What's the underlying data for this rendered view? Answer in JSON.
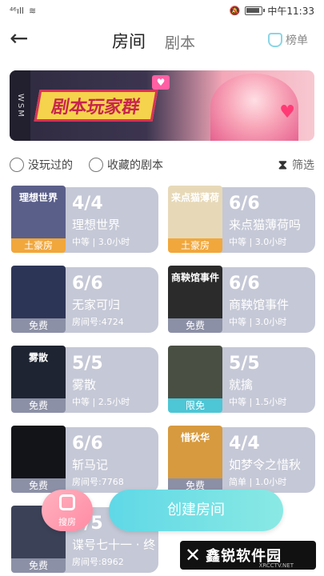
{
  "status_bar": {
    "signal": "⁴⁶ıll",
    "wifi": "≋",
    "time": "中午11:33"
  },
  "header": {
    "tabs": [
      {
        "label": "房间",
        "active": true
      },
      {
        "label": "剧本",
        "active": false
      }
    ],
    "rank_label": "榜单"
  },
  "banner": {
    "side_text": "WSM",
    "title": "剧本玩家群"
  },
  "filters": {
    "options": [
      "没玩过的",
      "收藏的剧本"
    ],
    "screen_label": "筛选"
  },
  "rooms": [
    {
      "thumb_title": "理想世界",
      "tag": "土豪房",
      "count": "4/4",
      "name": "理想世界",
      "meta": "中等 | 3.0小时",
      "art": "#5a5f8a"
    },
    {
      "thumb_title": "来点猫薄荷",
      "tag": "土豪房",
      "count": "6/6",
      "name": "来点猫薄荷吗",
      "meta": "中等 | 3.0小时",
      "art": "#e7d9b8"
    },
    {
      "thumb_title": "",
      "tag": "免费",
      "count": "6/6",
      "name": "无家可归",
      "meta": "房间号:4724",
      "art": "#2d3557"
    },
    {
      "thumb_title": "商鞅馆事件",
      "tag": "免费",
      "count": "6/6",
      "name": "商鞅馆事件",
      "meta": "中等 | 3.0小时",
      "art": "#2b2b2b"
    },
    {
      "thumb_title": "雾散",
      "tag": "免费",
      "count": "5/5",
      "name": "雾散",
      "meta": "中等 | 2.5小时",
      "art": "#1e2431"
    },
    {
      "thumb_title": "",
      "tag": "限免",
      "count": "5/5",
      "name": "就擒",
      "meta": "中等 | 1.5小时",
      "art": "#4a4f44"
    },
    {
      "thumb_title": "",
      "tag": "免费",
      "count": "6/6",
      "name": "斩马记",
      "meta": "房间号:7768",
      "art": "#121418"
    },
    {
      "thumb_title": "惜秋华",
      "tag": "免费",
      "count": "4/4",
      "name": "如梦令之惜秋",
      "meta": "简单 | 1.0小时",
      "art": "#d79a3e"
    },
    {
      "thumb_title": "",
      "tag": "免费",
      "count": "5/5",
      "name": "谍号七十一 · 终",
      "meta": "房间号:8962",
      "art": "#3b4258"
    }
  ],
  "bottom": {
    "search_label": "搜房",
    "create_label": "创建房间"
  },
  "watermark": {
    "logo": "✕",
    "text": "鑫锐软件园",
    "sub": "XRCCTV.NET"
  }
}
